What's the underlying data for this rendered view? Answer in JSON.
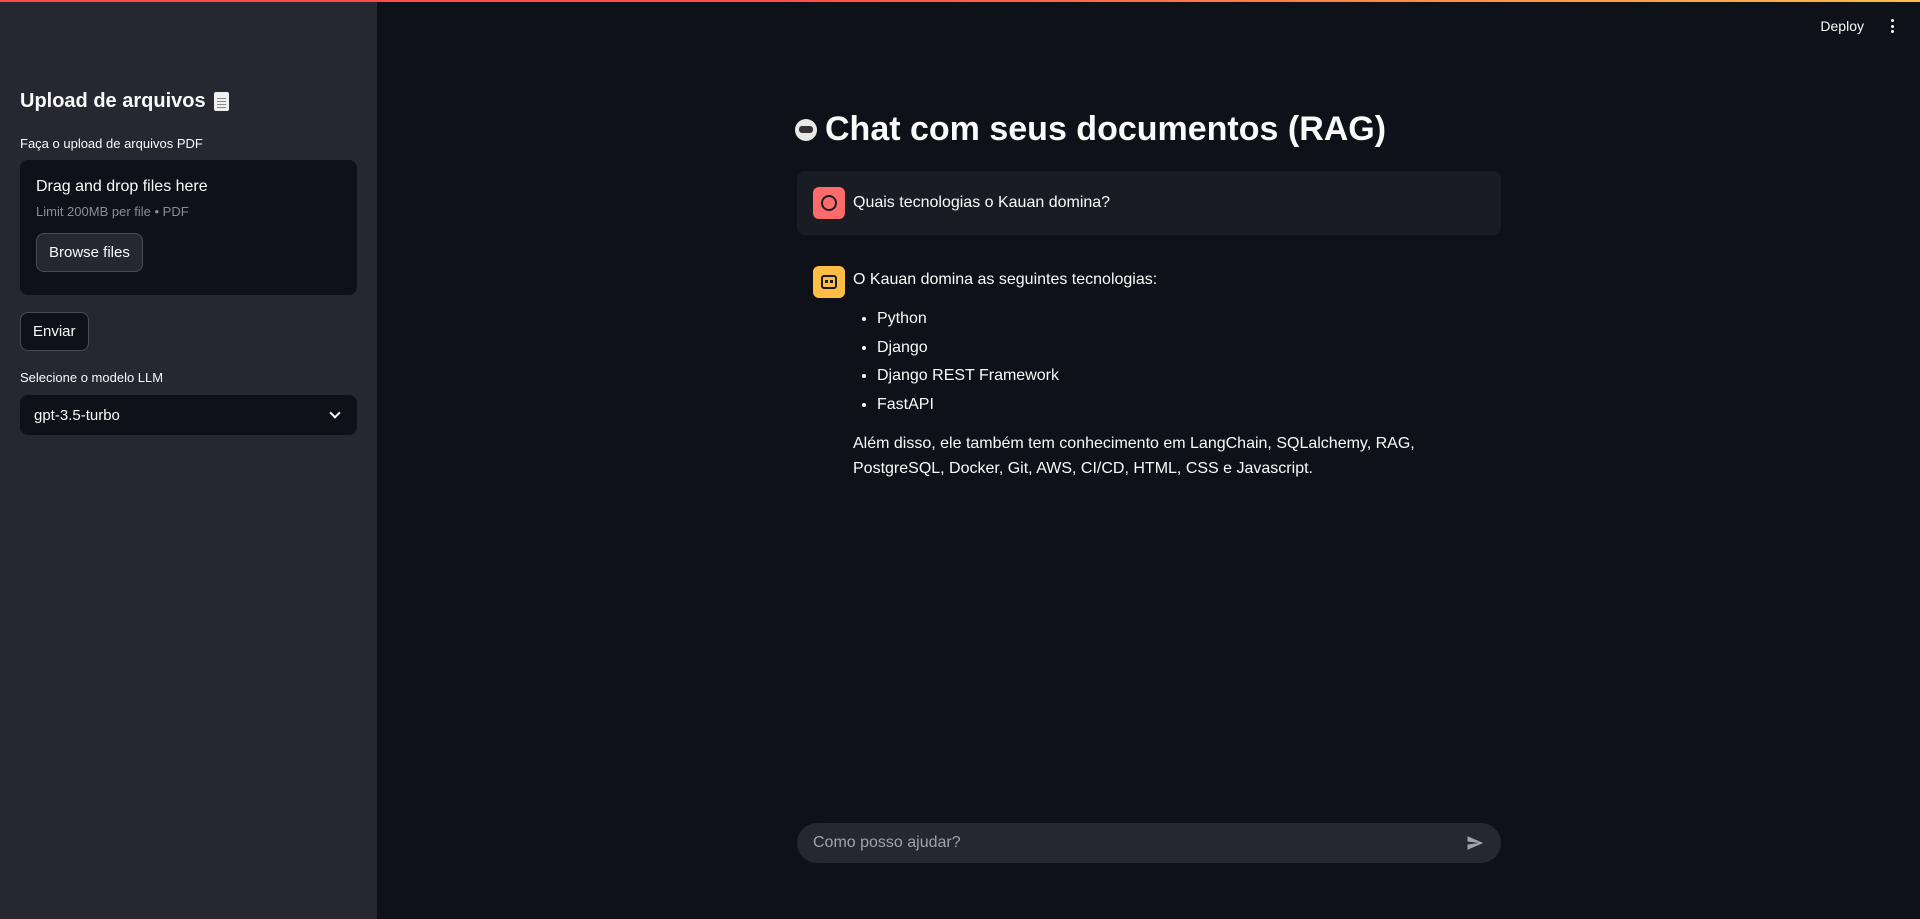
{
  "header": {
    "deploy_label": "Deploy"
  },
  "sidebar": {
    "title": "Upload de arquivos",
    "title_icon": "page-facing-up-icon",
    "upload_label": "Faça o upload de arquivos PDF",
    "dropzone_title": "Drag and drop files here",
    "dropzone_sub": "Limit 200MB per file • PDF",
    "browse_label": "Browse files",
    "send_label": "Enviar",
    "model_label": "Selecione o modelo LLM",
    "model_value": "gpt-3.5-turbo"
  },
  "main": {
    "title": "Chat com seus documentos (RAG)",
    "title_icon": "robot-face-icon",
    "messages": [
      {
        "role": "user",
        "text": "Quais tecnologias o Kauan domina?"
      },
      {
        "role": "assistant",
        "intro": "O Kauan domina as seguintes tecnologias:",
        "list": [
          "Python",
          "Django",
          "Django REST Framework",
          "FastAPI"
        ],
        "outro": "Além disso, ele também tem conhecimento em LangChain, SQLalchemy, RAG, PostgreSQL, Docker, Git, AWS, CI/CD, HTML, CSS e Javascript."
      }
    ],
    "chat_placeholder": "Como posso ajudar?"
  },
  "colors": {
    "accent_red": "#ff4b4b",
    "accent_yellow": "#ffbd45",
    "sidebar_bg": "#262730",
    "main_bg": "#0e1117"
  }
}
